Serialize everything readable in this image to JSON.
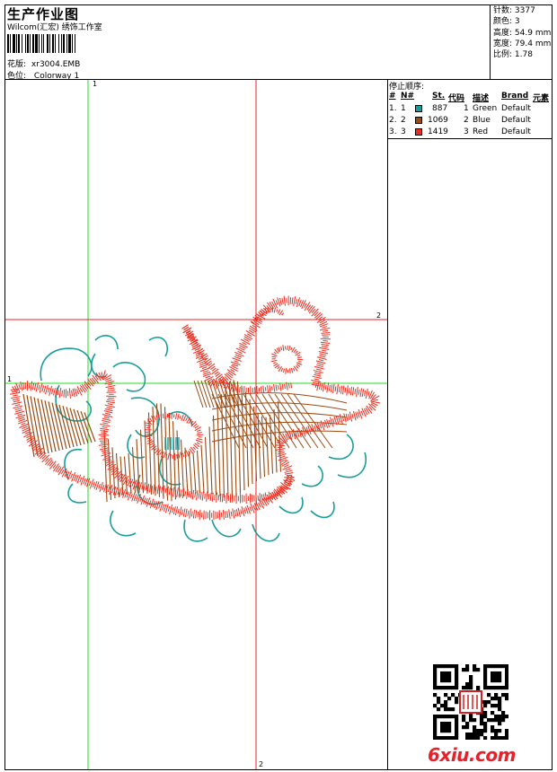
{
  "header": {
    "title": "生产作业图",
    "company": "Wilcom(汇宏) 绣饰工作室",
    "design_label": "花版:",
    "design_value": "xr3004.EMB",
    "colorway_label": "色位:",
    "colorway_value": "Colorway 1"
  },
  "stats": [
    {
      "label": "针数:",
      "value": "3377"
    },
    {
      "label": "颜色:",
      "value": "3"
    },
    {
      "label": "高度:",
      "value": "54.9 mm"
    },
    {
      "label": "宽度:",
      "value": "79.4 mm"
    },
    {
      "label": "比例:",
      "value": "1.78"
    }
  ],
  "stop_sequence": {
    "title": "停止顺序:",
    "columns": [
      "#",
      "N#",
      "St.",
      "代码",
      "描述",
      "Brand",
      "元素"
    ],
    "rows": [
      {
        "seq": "1.",
        "n": "1",
        "stitches": "887",
        "code": "1",
        "desc": "Green",
        "brand": "Default",
        "color": "#1a9c9c"
      },
      {
        "seq": "2.",
        "n": "2",
        "stitches": "1069",
        "code": "2",
        "desc": "Blue",
        "brand": "Default",
        "color": "#9a4a12"
      },
      {
        "seq": "3.",
        "n": "3",
        "stitches": "1419",
        "code": "3",
        "desc": "Red",
        "brand": "Default",
        "color": "#f02a1c"
      }
    ]
  },
  "guides": {
    "green_label_v": "1",
    "green_label_h": "1",
    "red_label_h": "2",
    "red_label_v": "2",
    "green_color": "#22dd22",
    "red_color": "#ee2020"
  },
  "watermark": {
    "text": "6xiu.com",
    "color": "#e8202a"
  }
}
